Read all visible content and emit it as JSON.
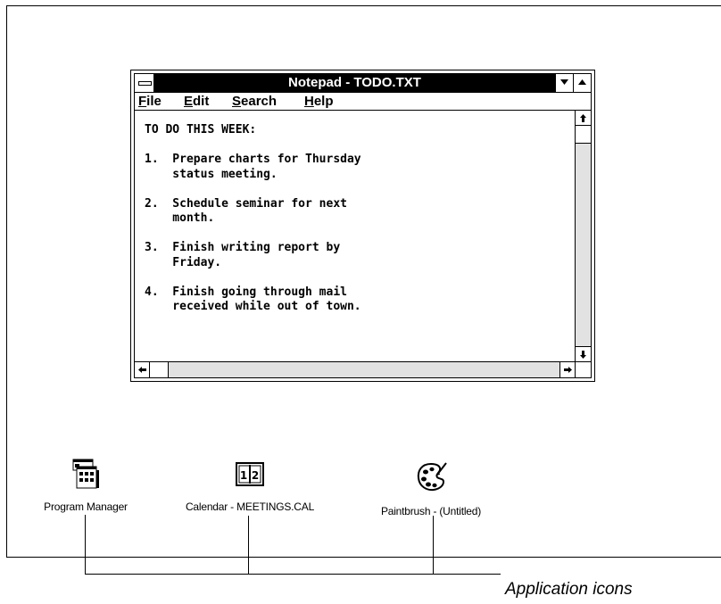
{
  "notepad": {
    "title": "Notepad - TODO.TXT",
    "menu": {
      "file": {
        "u": "F",
        "rest": "ile"
      },
      "edit": {
        "u": "E",
        "rest": "dit"
      },
      "search": {
        "u": "S",
        "rest": "earch"
      },
      "help": {
        "u": "H",
        "rest": "elp"
      }
    },
    "content": "TO DO THIS WEEK:\n\n1.  Prepare charts for Thursday\n    status meeting.\n\n2.  Schedule seminar for next\n    month.\n\n3.  Finish writing report by\n    Friday.\n\n4.  Finish going through mail\n    received while out of town."
  },
  "desktop_icons": [
    {
      "label": "Program Manager",
      "icon": "program-manager-icon"
    },
    {
      "label": "Calendar - MEETINGS.CAL",
      "icon": "calendar-icon"
    },
    {
      "label": "Paintbrush - (Untitled)",
      "icon": "paintbrush-palette-icon"
    }
  ],
  "caption": "Application icons"
}
